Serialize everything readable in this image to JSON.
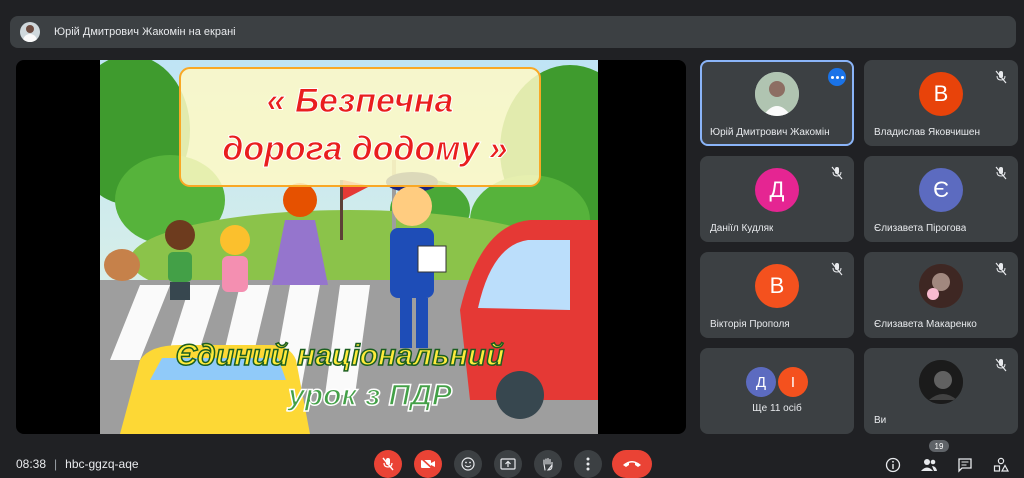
{
  "presentation_bar": {
    "presenting_text": "Юрій Дмитрович Жакомін на екрані"
  },
  "slide": {
    "title_line1": "« Безпечна",
    "title_line2": "дорога додому »",
    "subtitle_line1": "Єдиний національний",
    "subtitle_line2": "урок з ПДР"
  },
  "participants": [
    {
      "name": "Юрій Дмитрович Жакомін",
      "initial": "",
      "avatar_color": "#cfd8dc",
      "photo": true,
      "muted": false,
      "active": true
    },
    {
      "name": "Владислав Яковчишен",
      "initial": "В",
      "avatar_color": "#e8430a",
      "photo": false,
      "muted": true,
      "active": false
    },
    {
      "name": "Даніїл Кудляк",
      "initial": "Д",
      "avatar_color": "#e52592",
      "photo": false,
      "muted": true,
      "active": false
    },
    {
      "name": "Єлизавета Пірогова",
      "initial": "Є",
      "avatar_color": "#5c6bc0",
      "photo": false,
      "muted": true,
      "active": false
    },
    {
      "name": "Вікторія Прополя",
      "initial": "В",
      "avatar_color": "#f4511e",
      "photo": false,
      "muted": true,
      "active": false
    },
    {
      "name": "Єлизавета Макаренко",
      "initial": "",
      "avatar_color": "#4e342e",
      "photo": true,
      "muted": true,
      "active": false
    }
  ],
  "more_tile": {
    "label": "Ще 11 осіб",
    "initials": [
      {
        "initial": "Д",
        "color": "#5c6bc0"
      },
      {
        "initial": "І",
        "color": "#f4511e"
      }
    ]
  },
  "self_tile": {
    "name": "Ви",
    "muted": true
  },
  "bottom_bar": {
    "time": "08:38",
    "separator": "|",
    "meeting_code": "hbc-ggzq-aqe",
    "participant_count": "19"
  },
  "colors": {
    "background": "#202124",
    "tile": "#3c4043",
    "danger": "#ea4335",
    "accent": "#8ab4f8"
  },
  "icons": {
    "mic": "mic-off-icon",
    "camera": "camera-off-icon",
    "emoji": "emoji-icon",
    "present": "present-screen-icon",
    "hand": "raise-hand-icon",
    "more": "more-vert-icon",
    "hangup": "call-end-icon",
    "info": "info-icon",
    "people": "people-icon",
    "chat": "chat-icon",
    "activities": "activities-icon"
  }
}
